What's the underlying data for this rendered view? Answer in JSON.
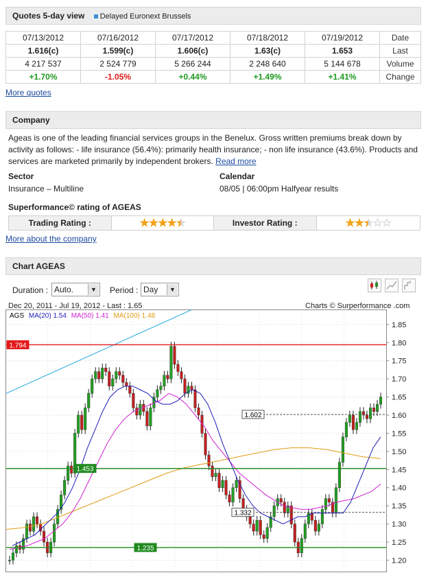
{
  "quotes": {
    "title": "Quotes 5-day view",
    "subtitle": "Delayed Euronext Brussels",
    "columns": [
      {
        "date": "07/13/2012",
        "last": "1.616(c)",
        "volume": "4 217 537",
        "change": "+1.70%",
        "dir": "pos"
      },
      {
        "date": "07/16/2012",
        "last": "1.599(c)",
        "volume": "2 524 779",
        "change": "-1.05%",
        "dir": "neg"
      },
      {
        "date": "07/17/2012",
        "last": "1.606(c)",
        "volume": "5 266 244",
        "change": "+0.44%",
        "dir": "pos"
      },
      {
        "date": "07/18/2012",
        "last": "1.63(c)",
        "volume": "2 248 640",
        "change": "+1.49%",
        "dir": "pos"
      },
      {
        "date": "07/19/2012",
        "last": "1.653",
        "volume": "5 144 678",
        "change": "+1.41%",
        "dir": "pos"
      }
    ],
    "row_labels": {
      "date": "Date",
      "last": "Last",
      "volume": "Volume",
      "change": "Change"
    },
    "more_link": "More quotes"
  },
  "company": {
    "title": "Company",
    "description": "Ageas is one of the leading financial services groups in the Benelux. Gross written premiums break down by activity as follows: - life insurance (56.4%): primarily health insurance; - non life insurance (43.6%). Products and services are marketed primarily by independent brokers.",
    "read_more": "Read more",
    "sector_label": "Sector",
    "sector_value": "Insurance – Multiline",
    "calendar_label": "Calendar",
    "calendar_value": "08/05 | 06:00pm Halfyear results",
    "rating_title": "Superformance© rating of AGEAS",
    "trading_label": "Trading Rating :",
    "trading_stars": 4.5,
    "investor_label": "Investor Rating :",
    "investor_stars": 2.5,
    "more_link": "More about the company"
  },
  "chart_section": {
    "title": "Chart AGEAS",
    "duration_label": "Duration :",
    "duration_value": "Auto.",
    "period_label": "Period :",
    "period_value": "Day",
    "info": "Dec 20, 2011 - Jul 19, 2012 - Last : 1.65",
    "credit": "Charts © Surperformance .com"
  },
  "chart_data": {
    "type": "line",
    "ticker": "AGS",
    "legend": [
      {
        "name": "MA(20) 1.54",
        "color": "#1c1cb8"
      },
      {
        "name": "MA(50) 1.41",
        "color": "#d21fd2"
      },
      {
        "name": "MA(100) 1.48",
        "color": "#e09a10"
      }
    ],
    "ylim": [
      1.18,
      1.88
    ],
    "y_ticks": [
      "1.85",
      "1.80",
      "1.75",
      "1.70",
      "1.65",
      "1.60",
      "1.55",
      "1.50",
      "1.45",
      "1.40",
      "1.35",
      "1.30",
      "1.25",
      "1.20"
    ],
    "levels": [
      {
        "value": 1.794,
        "label": "1.794",
        "color": "#e31a1a",
        "style": "solid"
      },
      {
        "value": 1.453,
        "label": "1.453",
        "color": "#1f8a1f",
        "style": "solid"
      },
      {
        "value": 1.235,
        "label": "1.235",
        "color": "#1f8a1f",
        "style": "solid"
      },
      {
        "value": 1.602,
        "label": "1.602",
        "color": "#555555",
        "style": "dashed"
      },
      {
        "value": 1.332,
        "label": "1.332",
        "color": "#555555",
        "style": "dashed"
      }
    ],
    "close": [
      1.2,
      1.22,
      1.24,
      1.23,
      1.26,
      1.3,
      1.28,
      1.32,
      1.3,
      1.28,
      1.25,
      1.22,
      1.25,
      1.3,
      1.34,
      1.38,
      1.42,
      1.46,
      1.44,
      1.55,
      1.6,
      1.56,
      1.62,
      1.66,
      1.7,
      1.72,
      1.7,
      1.73,
      1.72,
      1.68,
      1.7,
      1.72,
      1.71,
      1.69,
      1.68,
      1.66,
      1.62,
      1.6,
      1.63,
      1.61,
      1.57,
      1.62,
      1.65,
      1.67,
      1.68,
      1.71,
      1.7,
      1.79,
      1.74,
      1.72,
      1.7,
      1.66,
      1.68,
      1.67,
      1.62,
      1.6,
      1.55,
      1.49,
      1.46,
      1.43,
      1.44,
      1.4,
      1.42,
      1.38,
      1.36,
      1.4,
      1.42,
      1.37,
      1.34,
      1.32,
      1.3,
      1.28,
      1.31,
      1.27,
      1.26,
      1.29,
      1.32,
      1.35,
      1.37,
      1.36,
      1.33,
      1.35,
      1.3,
      1.25,
      1.22,
      1.26,
      1.3,
      1.33,
      1.31,
      1.28,
      1.3,
      1.34,
      1.37,
      1.36,
      1.33,
      1.4,
      1.47,
      1.54,
      1.58,
      1.6,
      1.56,
      1.58,
      1.61,
      1.6,
      1.59,
      1.62,
      1.61,
      1.63,
      1.65
    ],
    "ma20": [
      1.24,
      1.25,
      1.26,
      1.27,
      1.29,
      1.31,
      1.33,
      1.36,
      1.4,
      1.45,
      1.51,
      1.56,
      1.61,
      1.65,
      1.67,
      1.68,
      1.68,
      1.67,
      1.66,
      1.64,
      1.63,
      1.63,
      1.64,
      1.66,
      1.67,
      1.66,
      1.63,
      1.58,
      1.52,
      1.47,
      1.42,
      1.38,
      1.35,
      1.33,
      1.32,
      1.31,
      1.3,
      1.31,
      1.32,
      1.32,
      1.33,
      1.33,
      1.33,
      1.33,
      1.33,
      1.36,
      1.41,
      1.46,
      1.51,
      1.54
    ],
    "ma50": [
      1.23,
      1.235,
      1.24,
      1.25,
      1.26,
      1.28,
      1.3,
      1.33,
      1.37,
      1.42,
      1.47,
      1.52,
      1.56,
      1.59,
      1.61,
      1.62,
      1.63,
      1.64,
      1.66,
      1.65,
      1.63,
      1.6,
      1.57,
      1.53,
      1.5,
      1.47,
      1.44,
      1.42,
      1.4,
      1.38,
      1.365,
      1.35,
      1.345,
      1.34,
      1.34,
      1.345,
      1.35,
      1.36,
      1.365,
      1.37,
      1.38,
      1.39,
      1.41
    ],
    "ma100": [
      1.285,
      1.29,
      1.3,
      1.32,
      1.34,
      1.36,
      1.38,
      1.4,
      1.42,
      1.44,
      1.455,
      1.465,
      1.475,
      1.485,
      1.495,
      1.505,
      1.51,
      1.51,
      1.505,
      1.495,
      1.485,
      1.48
    ],
    "trendline": {
      "from": 1.66,
      "to": 1.915
    }
  }
}
